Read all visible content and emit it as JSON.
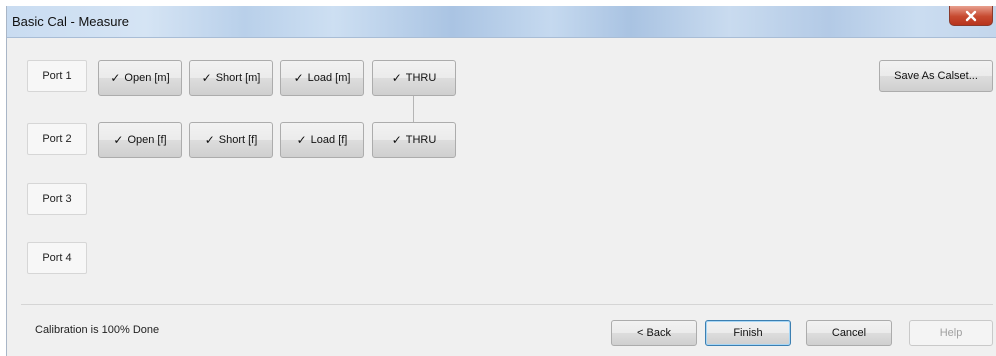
{
  "window": {
    "title": "Basic Cal - Measure"
  },
  "ports": [
    {
      "label": "Port 1",
      "standards": [
        {
          "label": "Open [m]",
          "checked": true
        },
        {
          "label": "Short [m]",
          "checked": true
        },
        {
          "label": "Load [m]",
          "checked": true
        },
        {
          "label": "THRU",
          "checked": true
        }
      ]
    },
    {
      "label": "Port 2",
      "standards": [
        {
          "label": "Open [f]",
          "checked": true
        },
        {
          "label": "Short [f]",
          "checked": true
        },
        {
          "label": "Load [f]",
          "checked": true
        },
        {
          "label": "THRU",
          "checked": true
        }
      ]
    },
    {
      "label": "Port 3",
      "standards": []
    },
    {
      "label": "Port 4",
      "standards": []
    }
  ],
  "check_glyph": "✓",
  "buttons": {
    "save_calset": "Save As Calset...",
    "back": "< Back",
    "finish": "Finish",
    "cancel": "Cancel",
    "help": "Help"
  },
  "status": {
    "text": "Calibration is 100% Done"
  },
  "colors": {
    "close_button": "#c74a30",
    "window_bg": "#f0f0f0",
    "default_button_border": "#3c7fb1"
  }
}
